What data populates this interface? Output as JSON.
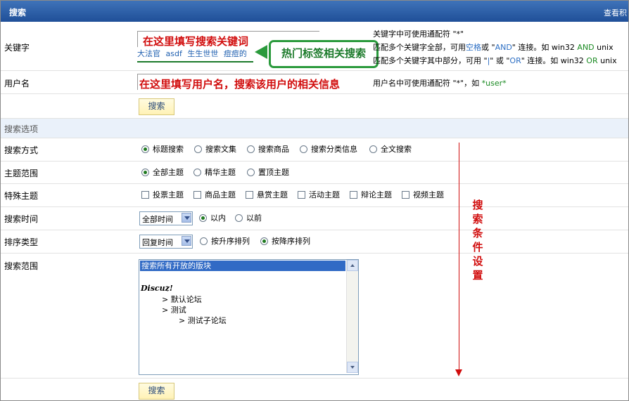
{
  "header": {
    "title": "搜索",
    "link": "查看积"
  },
  "keyword": {
    "label": "关键字",
    "annotation": "在这里填写搜索关键词",
    "hot_tags": "大法官 asdf 生生世世 痘痘的",
    "callout": "热门标签相关搜索",
    "hint1": "关键字中可使用通配符 \"*\"",
    "hint2_a": "匹配多个关键字全部，可用",
    "hint2_b": "空格",
    "hint2_c": "或 \"",
    "hint2_d": "AND",
    "hint2_e": "\" 连接。如 win32 ",
    "hint2_f": "AND",
    "hint2_g": " unix",
    "hint3_a": "匹配多个关键字其中部分，可用 \"",
    "hint3_b": "|",
    "hint3_c": "\" 或 \"",
    "hint3_d": "OR",
    "hint3_e": "\" 连接。如 win32 ",
    "hint3_f": "OR",
    "hint3_g": " unix"
  },
  "username": {
    "label": "用户名",
    "annotation": "在这里填写用户名，搜索该用户的相关信息",
    "hint_a": "用户名中可使用通配符 \"*\"，如 ",
    "hint_b": "*user*"
  },
  "search_button": "搜索",
  "options_section": "搜索选项",
  "search_method": {
    "label": "搜索方式",
    "options": [
      "标题搜索",
      "搜索文集",
      "搜索商品",
      "搜索分类信息",
      "全文搜索"
    ]
  },
  "topic_scope": {
    "label": "主题范围",
    "options": [
      "全部主题",
      "精华主题",
      "置顶主题"
    ]
  },
  "special_topic": {
    "label": "特殊主题",
    "options": [
      "投票主题",
      "商品主题",
      "悬赏主题",
      "活动主题",
      "辩论主题",
      "视频主题"
    ]
  },
  "search_time": {
    "label": "搜索时间",
    "select": "全部时间",
    "options": [
      "以内",
      "以前"
    ]
  },
  "sort_type": {
    "label": "排序类型",
    "select": "回复时间",
    "options": [
      "按升序排列",
      "按降序排列"
    ]
  },
  "search_scope": {
    "label": "搜索范围",
    "selected": "搜索所有开放的版块",
    "forum_root": "Discuz!",
    "items": [
      "> 默认论坛",
      "> 测试",
      "> 测试子论坛"
    ]
  },
  "side_annotation": "搜索条件设置",
  "colors": {
    "header": "#2a5ca6",
    "annotation_red": "#d10d0d",
    "callout_green": "#2a9a3c"
  }
}
